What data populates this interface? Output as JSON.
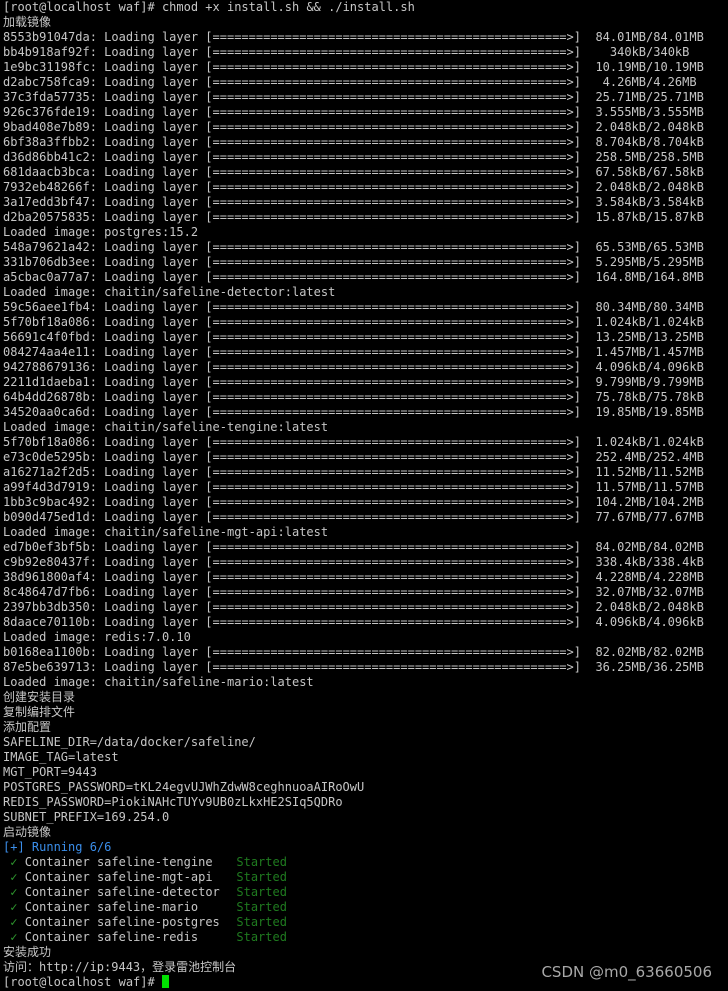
{
  "terminal": {
    "loading_label": "Loading layer",
    "colors": {
      "text": "#c6c6c6",
      "running": "#3b8eea",
      "started": "#1f7a1f",
      "cursor": "#00e000"
    },
    "lines": [
      {
        "type": "prompt",
        "prompt": "[root@localhost waf]# ",
        "command": "chmod +x install.sh && ./install.sh"
      },
      {
        "type": "text",
        "text": "加载镜像"
      },
      {
        "type": "layer",
        "id": "8553b91047da",
        "size": "84.01MB/84.01MB"
      },
      {
        "type": "layer",
        "id": "bb4b918af92f",
        "size": "340kB/340kB"
      },
      {
        "type": "layer",
        "id": "1e9bc31198fc",
        "size": "10.19MB/10.19MB"
      },
      {
        "type": "layer",
        "id": "d2abc758fca9",
        "size": "4.26MB/4.26MB"
      },
      {
        "type": "layer",
        "id": "37c3fda57735",
        "size": "25.71MB/25.71MB"
      },
      {
        "type": "layer",
        "id": "926c376fde19",
        "size": "3.555MB/3.555MB"
      },
      {
        "type": "layer",
        "id": "9bad408e7b89",
        "size": "2.048kB/2.048kB"
      },
      {
        "type": "layer",
        "id": "6bf38a3ffbb2",
        "size": "8.704kB/8.704kB"
      },
      {
        "type": "layer",
        "id": "d36d86bb41c2",
        "size": "258.5MB/258.5MB"
      },
      {
        "type": "layer",
        "id": "681daacb3bca",
        "size": "67.58kB/67.58kB"
      },
      {
        "type": "layer",
        "id": "7932eb48266f",
        "size": "2.048kB/2.048kB"
      },
      {
        "type": "layer",
        "id": "3a17edd3bf47",
        "size": "3.584kB/3.584kB"
      },
      {
        "type": "layer",
        "id": "d2ba20575835",
        "size": "15.87kB/15.87kB"
      },
      {
        "type": "text",
        "text": "Loaded image: postgres:15.2"
      },
      {
        "type": "layer",
        "id": "548a79621a42",
        "size": "65.53MB/65.53MB"
      },
      {
        "type": "layer",
        "id": "331b706db3ee",
        "size": "5.295MB/5.295MB"
      },
      {
        "type": "layer",
        "id": "a5cbac0a77a7",
        "size": "164.8MB/164.8MB"
      },
      {
        "type": "text",
        "text": "Loaded image: chaitin/safeline-detector:latest"
      },
      {
        "type": "layer",
        "id": "59c56aee1fb4",
        "size": "80.34MB/80.34MB"
      },
      {
        "type": "layer",
        "id": "5f70bf18a086",
        "size": "1.024kB/1.024kB"
      },
      {
        "type": "layer",
        "id": "56691c4f0fbd",
        "size": "13.25MB/13.25MB"
      },
      {
        "type": "layer",
        "id": "084274aa4e11",
        "size": "1.457MB/1.457MB"
      },
      {
        "type": "layer",
        "id": "942788679136",
        "size": "4.096kB/4.096kB"
      },
      {
        "type": "layer",
        "id": "2211d1daeba1",
        "size": "9.799MB/9.799MB"
      },
      {
        "type": "layer",
        "id": "64b4dd26878b",
        "size": "75.78kB/75.78kB"
      },
      {
        "type": "layer",
        "id": "34520aa0ca6d",
        "size": "19.85MB/19.85MB"
      },
      {
        "type": "text",
        "text": "Loaded image: chaitin/safeline-tengine:latest"
      },
      {
        "type": "layer",
        "id": "5f70bf18a086",
        "size": "1.024kB/1.024kB"
      },
      {
        "type": "layer",
        "id": "e73c0de5295b",
        "size": "252.4MB/252.4MB"
      },
      {
        "type": "layer",
        "id": "a16271a2f2d5",
        "size": "11.52MB/11.52MB"
      },
      {
        "type": "layer",
        "id": "a99f4d3d7919",
        "size": "11.57MB/11.57MB"
      },
      {
        "type": "layer",
        "id": "1bb3c9bac492",
        "size": "104.2MB/104.2MB"
      },
      {
        "type": "layer",
        "id": "b090d475ed1d",
        "size": "77.67MB/77.67MB"
      },
      {
        "type": "text",
        "text": "Loaded image: chaitin/safeline-mgt-api:latest"
      },
      {
        "type": "layer",
        "id": "ed7b0ef3bf5b",
        "size": "84.02MB/84.02MB"
      },
      {
        "type": "layer",
        "id": "c9b92e80437f",
        "size": "338.4kB/338.4kB"
      },
      {
        "type": "layer",
        "id": "38d961800af4",
        "size": "4.228MB/4.228MB"
      },
      {
        "type": "layer",
        "id": "8c48647d7fb6",
        "size": "32.07MB/32.07MB"
      },
      {
        "type": "layer",
        "id": "2397bb3db350",
        "size": "2.048kB/2.048kB"
      },
      {
        "type": "layer",
        "id": "8daace70110b",
        "size": "4.096kB/4.096kB"
      },
      {
        "type": "text",
        "text": "Loaded image: redis:7.0.10"
      },
      {
        "type": "layer",
        "id": "b0168ea1100b",
        "size": "82.02MB/82.02MB"
      },
      {
        "type": "layer",
        "id": "87e5be639713",
        "size": "36.25MB/36.25MB"
      },
      {
        "type": "text",
        "text": "Loaded image: chaitin/safeline-mario:latest"
      },
      {
        "type": "text",
        "text": "创建安装目录"
      },
      {
        "type": "text",
        "text": "复制编排文件"
      },
      {
        "type": "text",
        "text": "添加配置"
      },
      {
        "type": "text",
        "text": "SAFELINE_DIR=/data/docker/safeline/"
      },
      {
        "type": "text",
        "text": "IMAGE_TAG=latest"
      },
      {
        "type": "text",
        "text": "MGT_PORT=9443"
      },
      {
        "type": "text",
        "text": "POSTGRES_PASSWORD=tKL24egvUJWhZdwW8ceghnuoaAIRoOwU"
      },
      {
        "type": "text",
        "text": "REDIS_PASSWORD=PiokiNAHcTUYv9UB0zLkxHE2SIq5QDRo"
      },
      {
        "type": "text",
        "text": "SUBNET_PREFIX=169.254.0"
      },
      {
        "type": "text",
        "text": "启动镜像"
      },
      {
        "type": "running",
        "text": "[+] Running 6/6"
      },
      {
        "type": "container",
        "label": "Container",
        "name": "safeline-tengine",
        "status": "Started"
      },
      {
        "type": "container",
        "label": "Container",
        "name": "safeline-mgt-api",
        "status": "Started"
      },
      {
        "type": "container",
        "label": "Container",
        "name": "safeline-detector",
        "status": "Started"
      },
      {
        "type": "container",
        "label": "Container",
        "name": "safeline-mario",
        "status": "Started"
      },
      {
        "type": "container",
        "label": "Container",
        "name": "safeline-postgres",
        "status": "Started"
      },
      {
        "type": "container",
        "label": "Container",
        "name": "safeline-redis",
        "status": "Started"
      },
      {
        "type": "text",
        "text": "安装成功"
      },
      {
        "type": "text",
        "text": "访问：http://ip:9443，登录雷池控制台"
      },
      {
        "type": "prompt",
        "prompt": "[root@localhost waf]# ",
        "command": "",
        "cursor": true
      }
    ]
  },
  "watermark": "CSDN @m0_63660506"
}
